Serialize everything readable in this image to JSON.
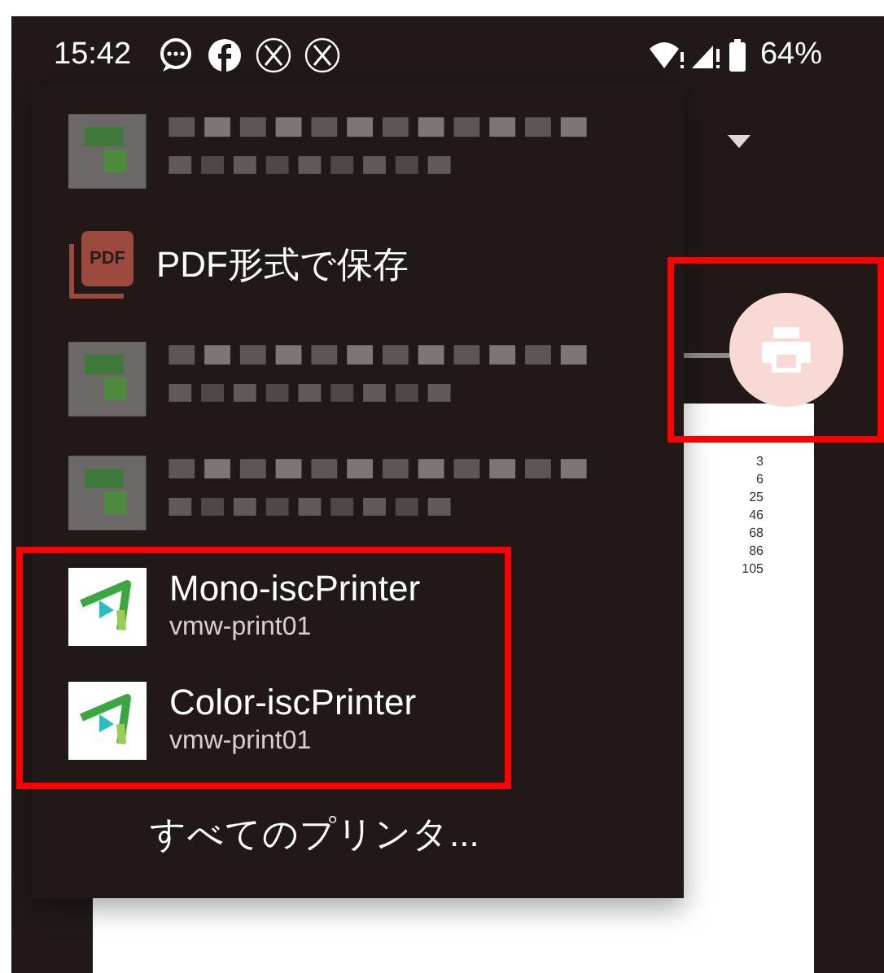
{
  "status_bar": {
    "time": "15:42",
    "battery": "64%"
  },
  "menu": {
    "items": [
      {
        "kind": "blurred"
      },
      {
        "kind": "pdf",
        "icon_text": "PDF",
        "title": "PDF形式で保存"
      },
      {
        "kind": "blurred"
      },
      {
        "kind": "blurred"
      },
      {
        "kind": "printer",
        "title": "Mono-iscPrinter",
        "subtitle": "vmw-print01"
      },
      {
        "kind": "printer",
        "title": "Color-iscPrinter",
        "subtitle": "vmw-print01"
      },
      {
        "kind": "more",
        "title": "すべてのプリンタ..."
      }
    ]
  },
  "preview": {
    "numbers": [
      "3",
      "6",
      "25",
      "46",
      "68",
      "86",
      "105"
    ]
  }
}
